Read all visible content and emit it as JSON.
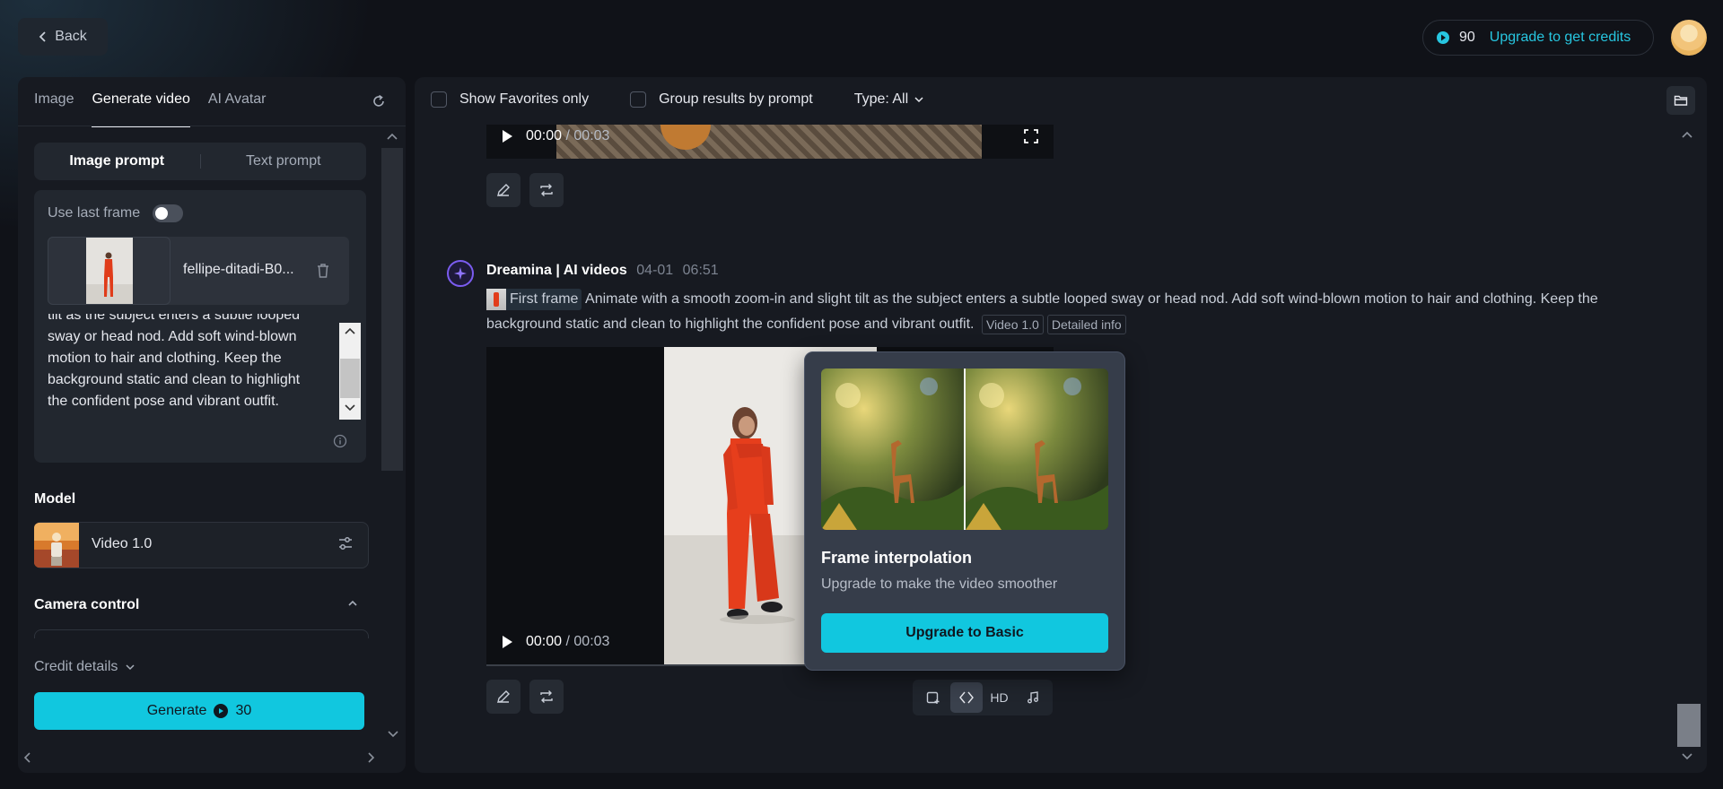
{
  "header": {
    "back_label": "Back",
    "credits": "90",
    "upgrade_label": "Upgrade to get credits"
  },
  "left": {
    "tabs": [
      {
        "label": "Image"
      },
      {
        "label": "Generate video"
      },
      {
        "label": "AI Avatar"
      }
    ],
    "segments": [
      {
        "label": "Image prompt"
      },
      {
        "label": "Text prompt"
      }
    ],
    "use_last_frame": "Use last frame",
    "file_name": "fellipe-ditadi-B0...",
    "prompt_lines": [
      "tilt as the subject enters a subtle looped",
      "sway or head nod. Add soft wind-blown",
      "motion to hair and clothing. Keep the",
      "background static and clean to highlight",
      "the confident pose and vibrant outfit."
    ],
    "model_label": "Model",
    "model_name": "Video 1.0",
    "camera_label": "Camera control",
    "credit_details": "Credit details",
    "generate_label": "Generate",
    "generate_cost": "30"
  },
  "filters": {
    "favorites": "Show Favorites only",
    "group": "Group results by prompt",
    "type": "Type: All"
  },
  "video_top": {
    "current": "00:00",
    "total": "/ 00:03"
  },
  "message": {
    "author": "Dreamina | AI videos",
    "date": "04-01",
    "time": "06:51",
    "first_frame": "First frame",
    "prompt": "Animate with a smooth zoom-in and slight tilt as the subject enters a subtle looped sway or head nod. Add soft wind-blown motion to hair and clothing. Keep the background static and clean to highlight the confident pose and vibrant outfit.",
    "model_tag": "Video 1.0",
    "info_tag": "Detailed info"
  },
  "video_main": {
    "current": "00:00",
    "total": "/ 00:03"
  },
  "popover": {
    "title": "Frame interpolation",
    "subtitle": "Upgrade to make the video smoother",
    "button": "Upgrade to Basic"
  },
  "toolbar": {
    "hd": "HD"
  },
  "colors": {
    "accent": "#11c7df",
    "panel": "#171a21",
    "background": "#101218"
  }
}
